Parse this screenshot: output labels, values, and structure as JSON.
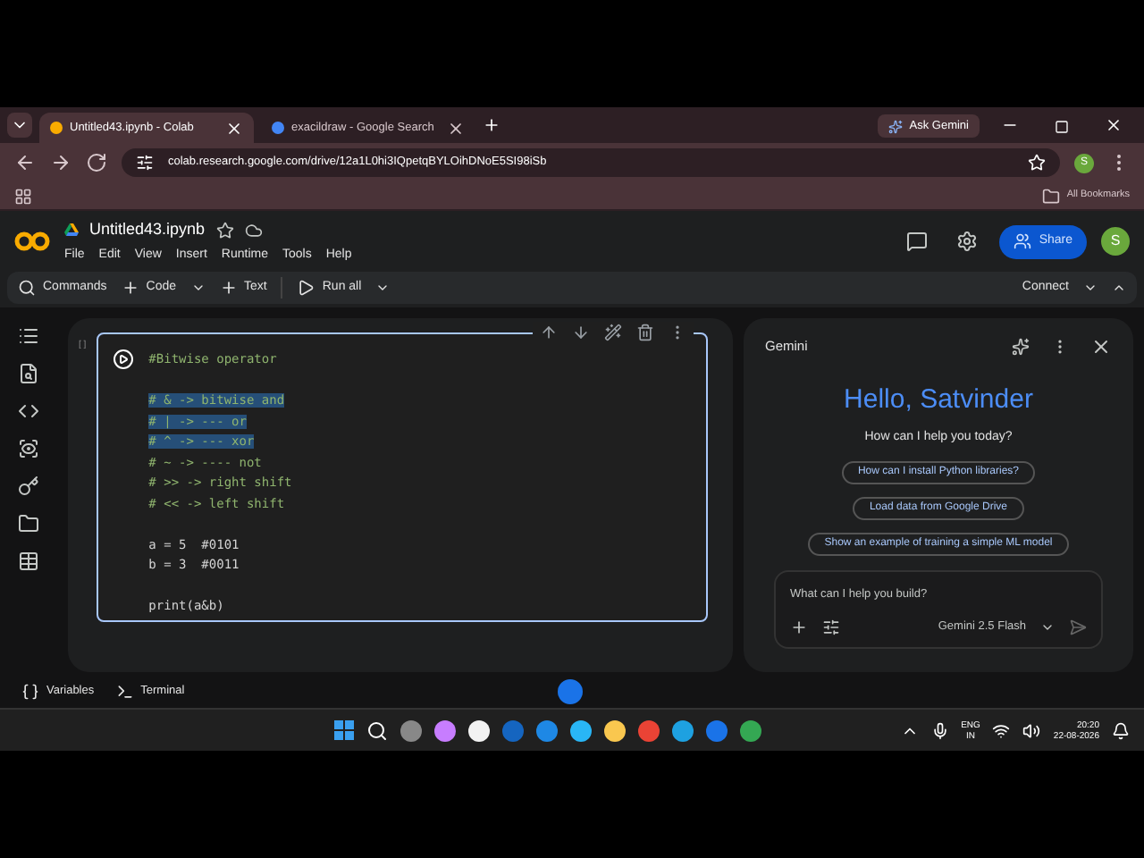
{
  "browser": {
    "tabs": [
      {
        "title": "Untitled43.ipynb - Colab",
        "selected": true
      },
      {
        "title": "exacildraw - Google Search",
        "selected": false
      }
    ],
    "ask_button": "Ask Gemini",
    "url": "colab.research.google.com/drive/12a1L0hi3IQpetqBYLOihDNoE5SI98iSb",
    "profile": "S",
    "bookmarks": "All Bookmarks"
  },
  "colab": {
    "notebook_title": "Untitled43.ipynb",
    "menu": [
      "File",
      "Edit",
      "View",
      "Insert",
      "Runtime",
      "Tools",
      "Help"
    ],
    "share": "Share",
    "avatar": "S",
    "toolbar": {
      "commands": "Commands",
      "code": "Code",
      "text": "Text",
      "run_all": "Run all",
      "connect": "Connect"
    },
    "cell": {
      "bracket": "[ ]",
      "lines": [
        {
          "kind": "comment",
          "text": "#Bitwise operator",
          "selected": false
        },
        {
          "kind": "blank"
        },
        {
          "kind": "comment",
          "text": "# & -> bitwise and",
          "selected": true
        },
        {
          "kind": "comment",
          "text": "# | -> --- or",
          "selected": true
        },
        {
          "kind": "comment",
          "text": "# ^ -> --- xor",
          "selected": true
        },
        {
          "kind": "comment",
          "text": "# ~ -> ---- not",
          "selected": false
        },
        {
          "kind": "comment",
          "text": "# >> -> right shift",
          "selected": false
        },
        {
          "kind": "comment",
          "text": "# << -> left shift",
          "selected": false
        },
        {
          "kind": "blank"
        },
        {
          "kind": "code",
          "text": "a = 5  #0101",
          "selected": false
        },
        {
          "kind": "code",
          "text": "b = 3  #0011",
          "selected": false
        },
        {
          "kind": "blank"
        },
        {
          "kind": "code",
          "text": "print(a&b)",
          "selected": false
        }
      ]
    },
    "gemini": {
      "title": "Gemini",
      "greeting": "Hello, Satvinder",
      "subtitle": "How can I help you today?",
      "suggestions": [
        "How can I install Python libraries?",
        "Load data from Google Drive",
        "Show an example of training a simple ML model"
      ],
      "input": {
        "placeholder": "What can I help you build?"
      },
      "model": "Gemini 2.5 Flash"
    },
    "bottom_bar": [
      "Variables",
      "Terminal"
    ]
  },
  "taskbar": {
    "language": "ENG",
    "region": "IN",
    "time": "20:20",
    "date": "22-08-2026"
  }
}
